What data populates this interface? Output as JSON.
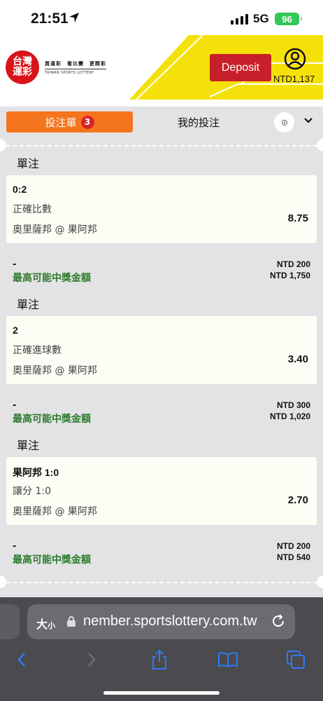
{
  "status_bar": {
    "time": "21:51",
    "network": "5G",
    "battery": "96"
  },
  "header": {
    "logo_line1": "台灣",
    "logo_line2": "運彩",
    "logo_tagline": "買運彩　看比賽　更精彩",
    "logo_subtitle": "TAIWAN SPORTS LOTTERY",
    "deposit_label": "Deposit",
    "balance": "NTD1,137",
    "colors": {
      "brand_red": "#d7141a",
      "yellow": "#f5e10a",
      "deposit": "#c8202a"
    }
  },
  "tabs": {
    "betslip_label": "投注單",
    "betslip_count": "3",
    "mybets_label": "我的投注",
    "active_color": "#f4751c"
  },
  "bets": [
    {
      "section_title": "單注",
      "selection": "0:2",
      "market": "正確比數",
      "event": "奧里薩邦 @ 果阿邦",
      "odds": "8.75",
      "dash": "-",
      "max_win_label": "最高可能中獎金額",
      "stake": "NTD 200",
      "max_win": "NTD 1,750"
    },
    {
      "section_title": "單注",
      "selection": "2",
      "market": "正確進球數",
      "event": "奧里薩邦 @ 果阿邦",
      "odds": "3.40",
      "dash": "-",
      "max_win_label": "最高可能中獎金額",
      "stake": "NTD 300",
      "max_win": "NTD 1,020"
    },
    {
      "section_title": "單注",
      "selection": "果阿邦 1:0",
      "market": "讓分 1:0",
      "event": "奧里薩邦 @ 果阿邦",
      "odds": "2.70",
      "dash": "-",
      "max_win_label": "最高可能中獎金額",
      "stake": "NTD 200",
      "max_win": "NTD 540"
    }
  ],
  "browser": {
    "text_size_label": "大",
    "text_size_small": "小",
    "url": "nember.sportslottery.com.tw"
  }
}
